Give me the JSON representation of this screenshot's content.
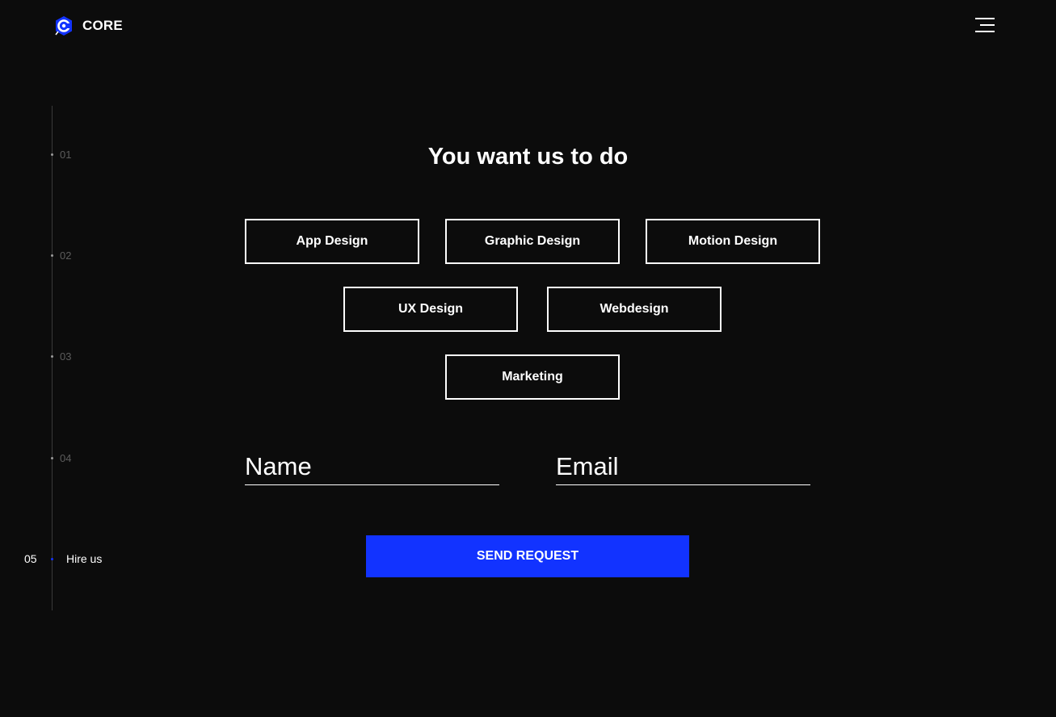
{
  "header": {
    "logo_text": "CORE",
    "logo_icon": "core-logo-icon",
    "menu_icon": "hamburger-menu-icon"
  },
  "side_nav": {
    "items": [
      {
        "number": "01",
        "label": ""
      },
      {
        "number": "02",
        "label": ""
      },
      {
        "number": "03",
        "label": ""
      },
      {
        "number": "04",
        "label": ""
      },
      {
        "number": "05",
        "label": "Hire us",
        "active": true
      }
    ]
  },
  "main": {
    "title": "You want us to do",
    "services": [
      "App Design",
      "Graphic Design",
      "Motion Design",
      "UX Design",
      "Webdesign",
      "Marketing"
    ],
    "form": {
      "name_placeholder": "Name",
      "email_placeholder": "Email",
      "name_value": "",
      "email_value": ""
    },
    "send_label": "SEND REQUEST"
  },
  "colors": {
    "background": "#0c0c0c",
    "accent": "#1233ff",
    "text": "#ffffff",
    "muted": "#5c5c5c"
  }
}
